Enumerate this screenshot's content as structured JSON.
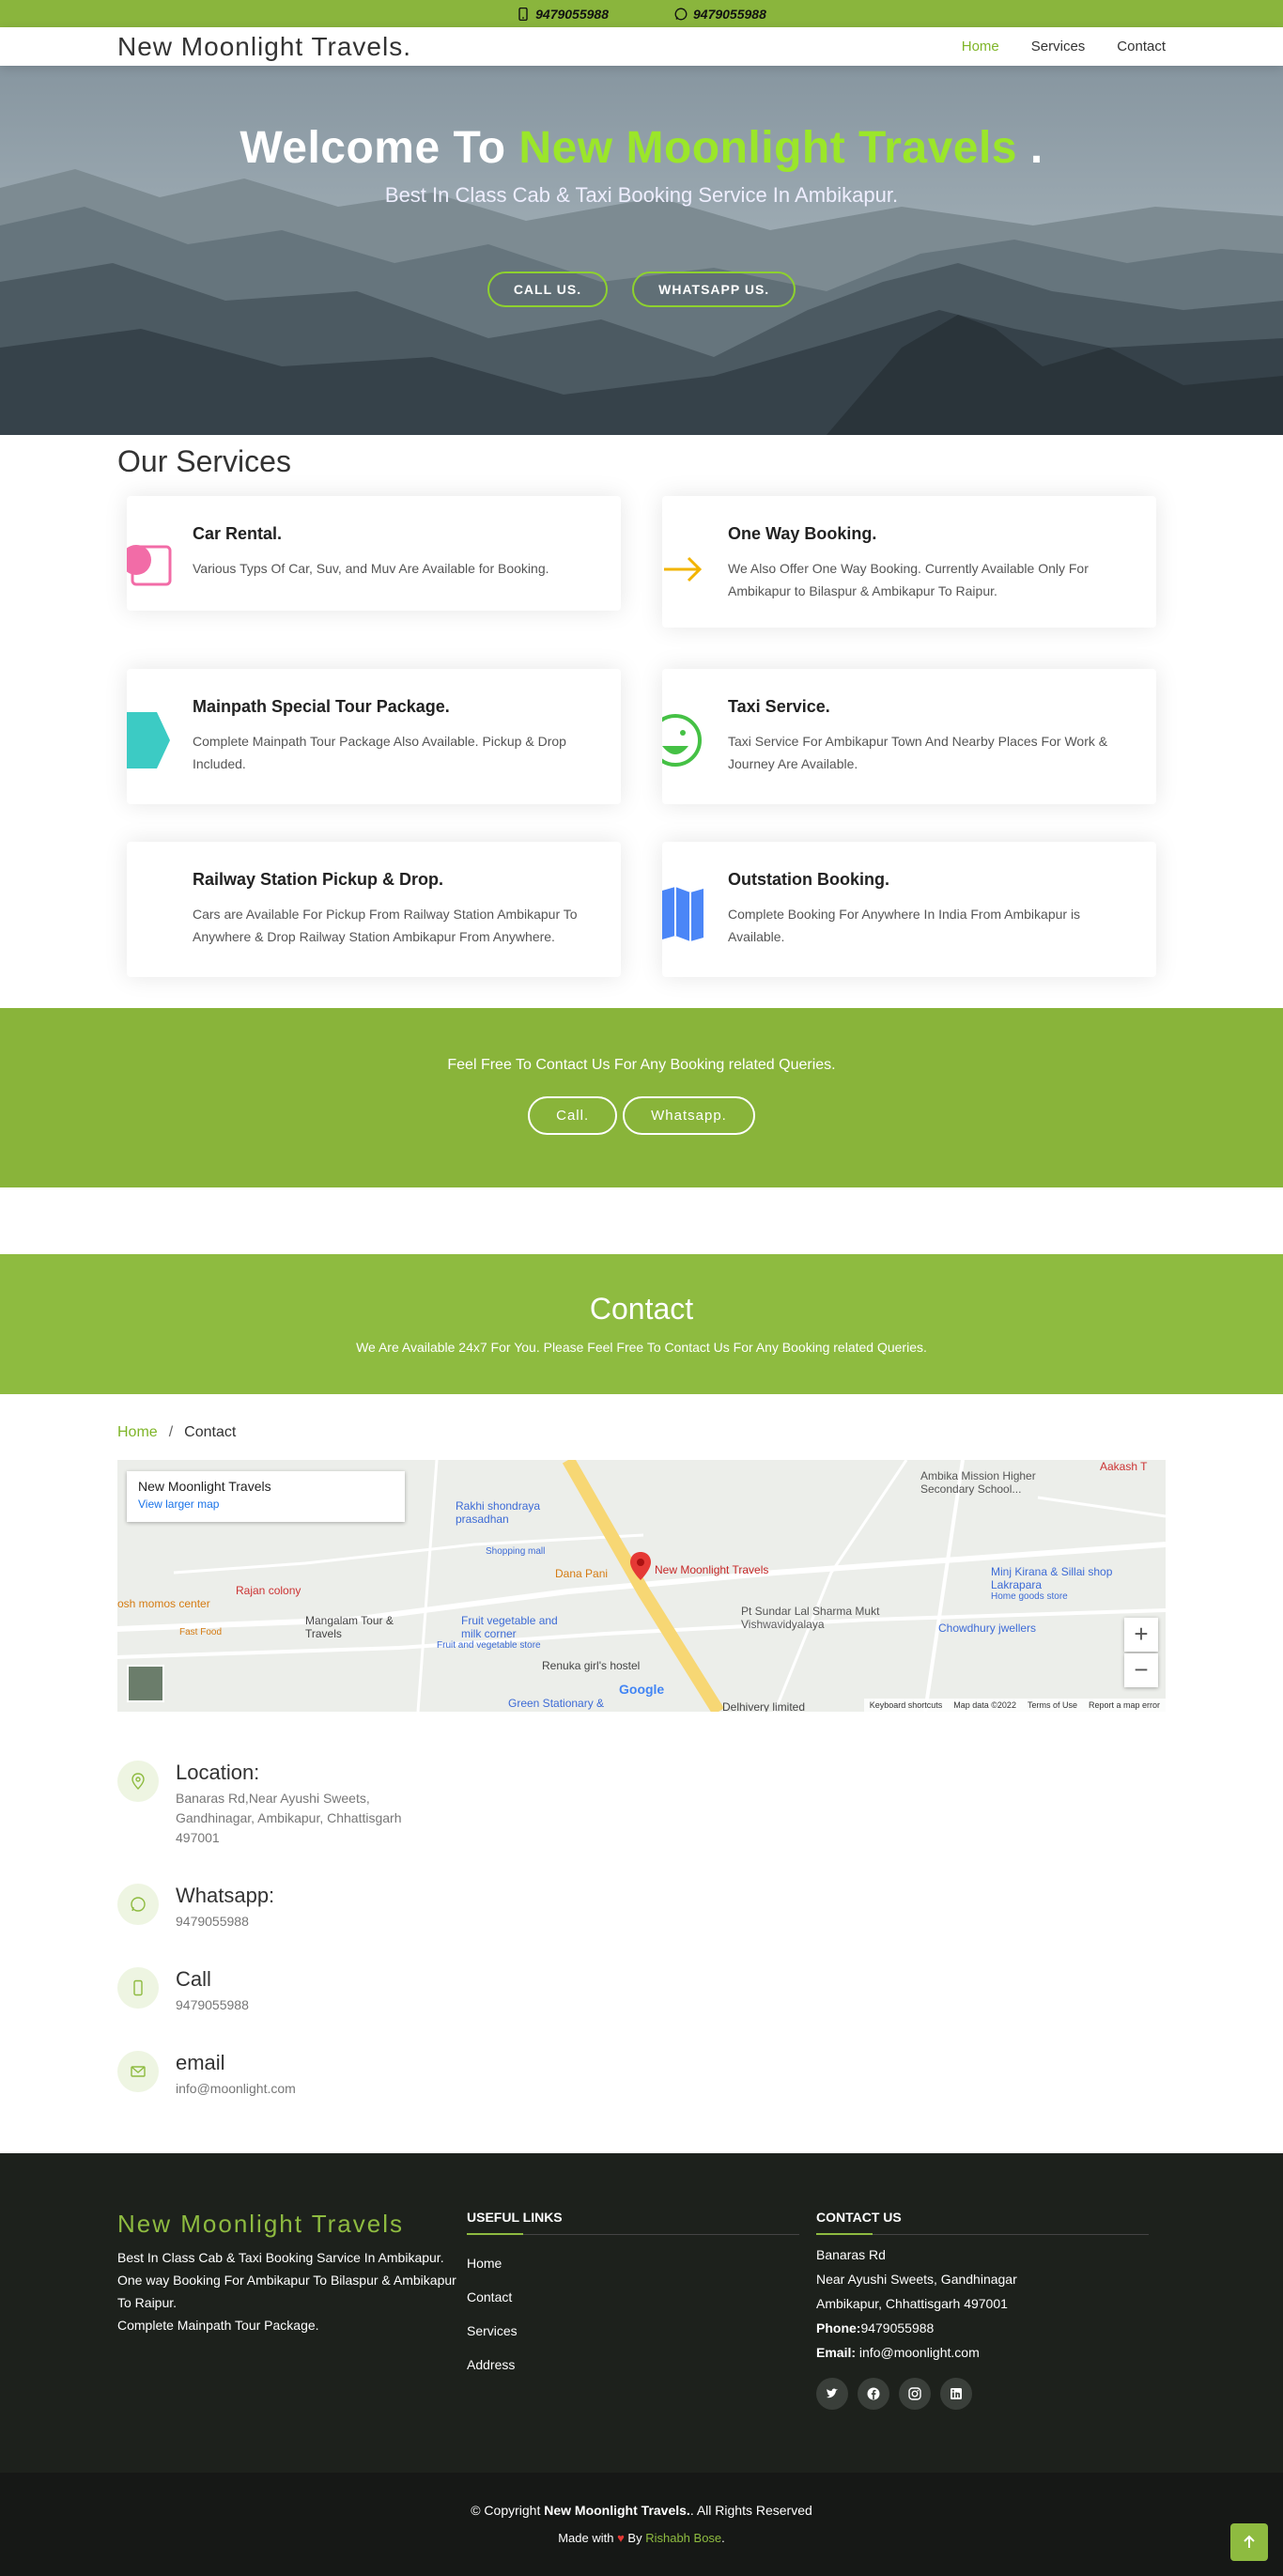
{
  "topbar": {
    "phone": "9479055988",
    "whatsapp": "9479055988"
  },
  "header": {
    "brand": "New Moonlight Travels.",
    "nav": [
      "Home",
      "Services",
      "Contact"
    ]
  },
  "hero": {
    "title_prefix": "Welcome To ",
    "title_highlight": "New Moonlight Travels",
    "title_suffix": " .",
    "subtitle": "Best In Class Cab & Taxi Booking Service In Ambikapur.",
    "btn_call": "CALL US.",
    "btn_whatsapp": "WHATSAPP US."
  },
  "services": {
    "heading": "Our Services",
    "items": [
      {
        "title": "Car Rental.",
        "text": "Various Typs Of Car, Suv, and Muv Are Available for Booking."
      },
      {
        "title": "One Way Booking.",
        "text": "We Also Offer One Way Booking. Currently Available Only For Ambikapur to Bilaspur & Ambikapur To Raipur."
      },
      {
        "title": "Mainpath Special Tour Package.",
        "text": "Complete Mainpath Tour Package Also Available. Pickup & Drop Included."
      },
      {
        "title": "Taxi Service.",
        "text": "Taxi Service For Ambikapur Town And Nearby Places For Work & Journey Are Available."
      },
      {
        "title": "Railway Station Pickup & Drop.",
        "text": "Cars are Available For Pickup From Railway Station Ambikapur To Anywhere & Drop Railway Station Ambikapur From Anywhere."
      },
      {
        "title": "Outstation Booking.",
        "text": "Complete Booking For Anywhere In India From Ambikapur is Available."
      }
    ]
  },
  "cta": {
    "text": "Feel Free To Contact Us For Any Booking related Queries.",
    "btn_call": "Call.",
    "btn_whatsapp": "Whatsapp."
  },
  "contact_banner": {
    "title": "Contact",
    "subtitle": "We Are Available 24x7 For You. Please Feel Free To Contact Us For Any Booking related Queries."
  },
  "breadcrumb": {
    "home": "Home",
    "sep": "/",
    "current": "Contact"
  },
  "map": {
    "place": "New Moonlight Travels",
    "link": "View larger map",
    "labels": {
      "ambika": "Ambika Mission Higher Secondary School...",
      "aakash": "Aakash T",
      "rakhi": "Rakhi shondraya prasadhan",
      "shopping": "Shopping mall",
      "danapani": "Dana Pani",
      "pin": "New Moonlight Travels",
      "minj": "Minj Kirana & Sillai shop Lakrapara",
      "homegoods": "Home goods store",
      "rajan": "Rajan colony",
      "momos": "osh momos center",
      "fastfood": "Fast Food",
      "mangalam": "Mangalam Tour & Travels",
      "fruit": "Fruit vegetable and milk corner",
      "fruit2": "Fruit and vegetable store",
      "sundar": "Pt Sundar Lal Sharma Mukt Vishwavidyalaya",
      "chowdhury": "Chowdhury jwellers",
      "renuka": "Renuka girl's hostel",
      "green": "Green Stationary &",
      "delhivery": "Delhivery limited",
      "google": "Google"
    },
    "footer": [
      "Keyboard shortcuts",
      "Map data ©2022",
      "Terms of Use",
      "Report a map error"
    ]
  },
  "info": [
    {
      "title": "Location:",
      "text": "Banaras Rd,Near Ayushi Sweets, Gandhinagar, Ambikapur, Chhattisgarh 497001",
      "icon": "location-icon"
    },
    {
      "title": "Whatsapp:",
      "text": "9479055988",
      "icon": "whatsapp-icon"
    },
    {
      "title": "Call",
      "text": "9479055988",
      "icon": "phone-icon"
    },
    {
      "title": "email",
      "text": "info@moonlight.com",
      "icon": "mail-icon"
    }
  ],
  "footer": {
    "brand": "New Moonlight Travels",
    "about_lines": [
      "Best In Class Cab & Taxi Booking Sarvice In Ambikapur.",
      "One way Booking For Ambikapur To Bilaspur & Ambikapur To Raipur.",
      "Complete Mainpath Tour Package."
    ],
    "links_title": "USEFUL LINKS",
    "links": [
      "Home",
      "Contact",
      "Services",
      "Address"
    ],
    "contact_title": "CONTACT US",
    "addr1": "Banaras Rd",
    "addr2": "Near Ayushi Sweets, Gandhinagar",
    "addr3": "Ambikapur, Chhattisgarh 497001",
    "phone_label": "Phone:",
    "phone": "9479055988",
    "email_label": "Email:",
    "email": "info@moonlight.com"
  },
  "copyright": {
    "prefix": "© Copyright ",
    "name": "New Moonlight Travels.",
    "suffix": ". All Rights Reserved",
    "made": "Made with",
    "by": "By",
    "author": "Rishabh Bose",
    "dot": "."
  },
  "colors": {
    "brand": "#8ebb40",
    "accent": "#9be62a",
    "footer": "#1d211c"
  }
}
